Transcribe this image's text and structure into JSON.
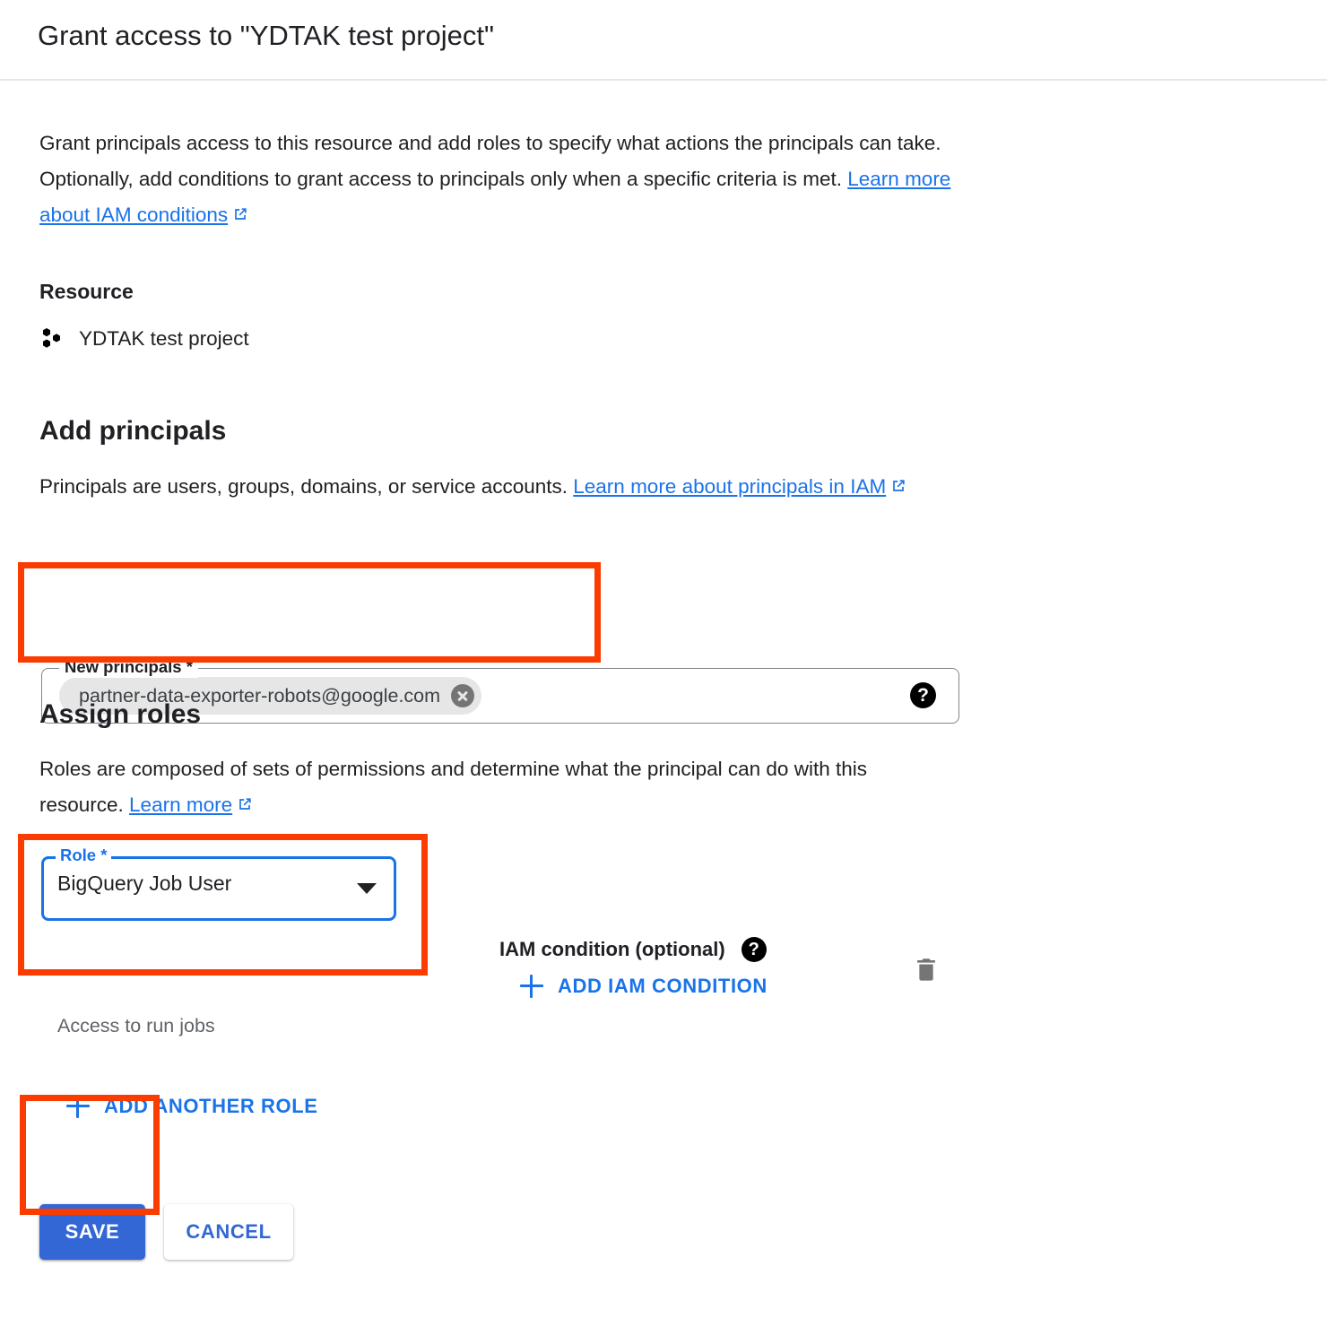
{
  "dialog": {
    "title": "Grant access to \"YDTAK test project\"",
    "intro": {
      "text_part1": "Grant principals access to this resource and add roles to specify what actions the principals can take. Optionally, add conditions to grant access to principals only when a specific criteria is met. ",
      "link_label": "Learn more about IAM conditions",
      "link_icon": "external-link-icon"
    }
  },
  "resource": {
    "heading": "Resource",
    "icon": "project-hexagons-icon",
    "name": "YDTAK test project"
  },
  "add_principals": {
    "heading": "Add principals",
    "description_part1": "Principals are users, groups, domains, or service accounts. ",
    "description_link": "Learn more about principals in IAM",
    "field": {
      "label": "New principals *",
      "chip_value": "partner-data-exporter-robots@google.com",
      "chip_remove_icon": "close-circle-icon",
      "help_icon": "help-icon",
      "help_glyph": "?"
    }
  },
  "assign_roles": {
    "heading": "Assign roles",
    "description_part1": "Roles are composed of sets of permissions and determine what the principal can do with this resource. ",
    "description_link": "Learn more",
    "role": {
      "label": "Role *",
      "value": "BigQuery Job User",
      "hint": "Access to run jobs",
      "caret_icon": "chevron-down-icon"
    },
    "iam_condition": {
      "label": "IAM condition (optional)",
      "help_icon": "help-icon",
      "help_glyph": "?",
      "add_label": "ADD IAM CONDITION",
      "delete_icon": "trash-icon"
    },
    "add_another_role_label": "ADD ANOTHER ROLE"
  },
  "actions": {
    "save_label": "SAVE",
    "cancel_label": "CANCEL"
  },
  "colors": {
    "accent_blue": "#1a73e8",
    "button_blue": "#3367d6",
    "annotation_red": "#fa3c00",
    "chip_gray": "#e6e6e6",
    "hint_gray": "#5f6368"
  }
}
